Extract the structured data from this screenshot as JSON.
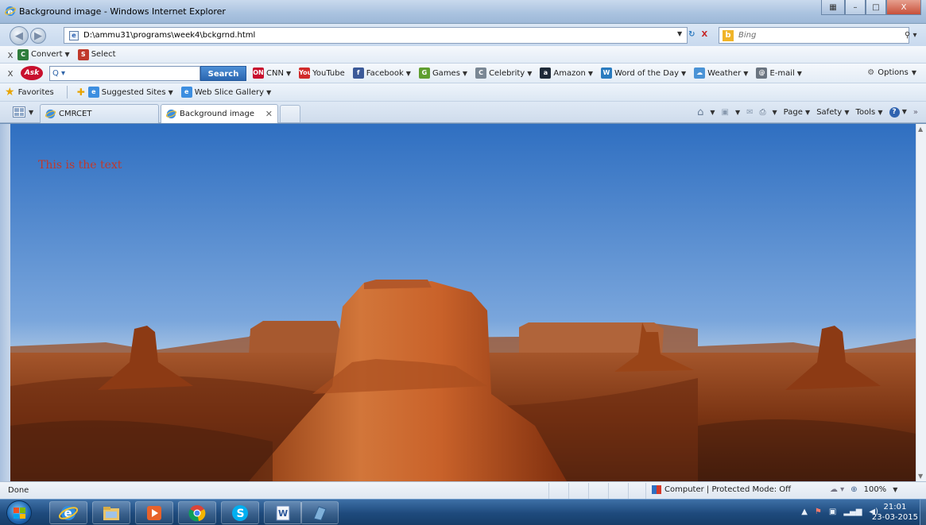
{
  "window": {
    "title": "Background image - Windows Internet Explorer",
    "controls": {
      "minimize": "–",
      "maximize": "□",
      "close": "X"
    }
  },
  "address_bar": {
    "url": "D:\\ammu31\\programs\\week4\\bckgrnd.html",
    "refresh_glyph": "⁴⁄",
    "stop_glyph": "X",
    "search_placeholder": "Bing",
    "search_logo": "b"
  },
  "convert_toolbar": {
    "close": "x",
    "convert_label": "Convert",
    "select_label": "Select"
  },
  "ask_toolbar": {
    "close": "x",
    "logo": "Ask",
    "input_value": "Q ▾",
    "search_button": "Search",
    "links": [
      {
        "label": "CNN",
        "icon": "cnn-icon",
        "color": "#c8102e",
        "glyph": "ON"
      },
      {
        "label": "YouTube",
        "icon": "youtube-icon",
        "color": "#d12b2b",
        "glyph": "You"
      },
      {
        "label": "Facebook",
        "icon": "facebook-icon",
        "color": "#3b5998",
        "glyph": "f"
      },
      {
        "label": "Games",
        "icon": "games-icon",
        "color": "#5f9e2f",
        "glyph": "G"
      },
      {
        "label": "Celebrity",
        "icon": "celebrity-icon",
        "color": "#7a8794",
        "glyph": "C"
      },
      {
        "label": "Amazon",
        "icon": "amazon-icon",
        "color": "#1f2a38",
        "glyph": "a"
      },
      {
        "label": "Word of the Day",
        "icon": "word-of-day-icon",
        "color": "#2a7bbf",
        "glyph": "W"
      },
      {
        "label": "Weather",
        "icon": "weather-icon",
        "color": "#4a93d6",
        "glyph": "☁"
      },
      {
        "label": "E-mail",
        "icon": "email-icon",
        "color": "#6a7480",
        "glyph": "@"
      }
    ],
    "options_label": "Options"
  },
  "favorites_bar": {
    "favorites_label": "Favorites",
    "suggested_sites": "Suggested Sites",
    "web_slice_gallery": "Web Slice Gallery"
  },
  "tabs": [
    {
      "label": "CMRCET",
      "active": false
    },
    {
      "label": "Background image",
      "active": true
    }
  ],
  "command_bar": {
    "page": "Page",
    "safety": "Safety",
    "tools": "Tools",
    "help": "?"
  },
  "page": {
    "text": "This is the text",
    "text_color": "#c0392b"
  },
  "status_bar": {
    "status": "Done",
    "zone": "Computer | Protected Mode: Off",
    "zoom": "100%"
  },
  "taskbar": {
    "apps": [
      "internet-explorer-icon",
      "file-explorer-icon",
      "media-player-icon",
      "chrome-icon",
      "skype-icon",
      "word-icon",
      "notepad-icon"
    ],
    "time": "21:01",
    "date": "23-03-2015"
  }
}
